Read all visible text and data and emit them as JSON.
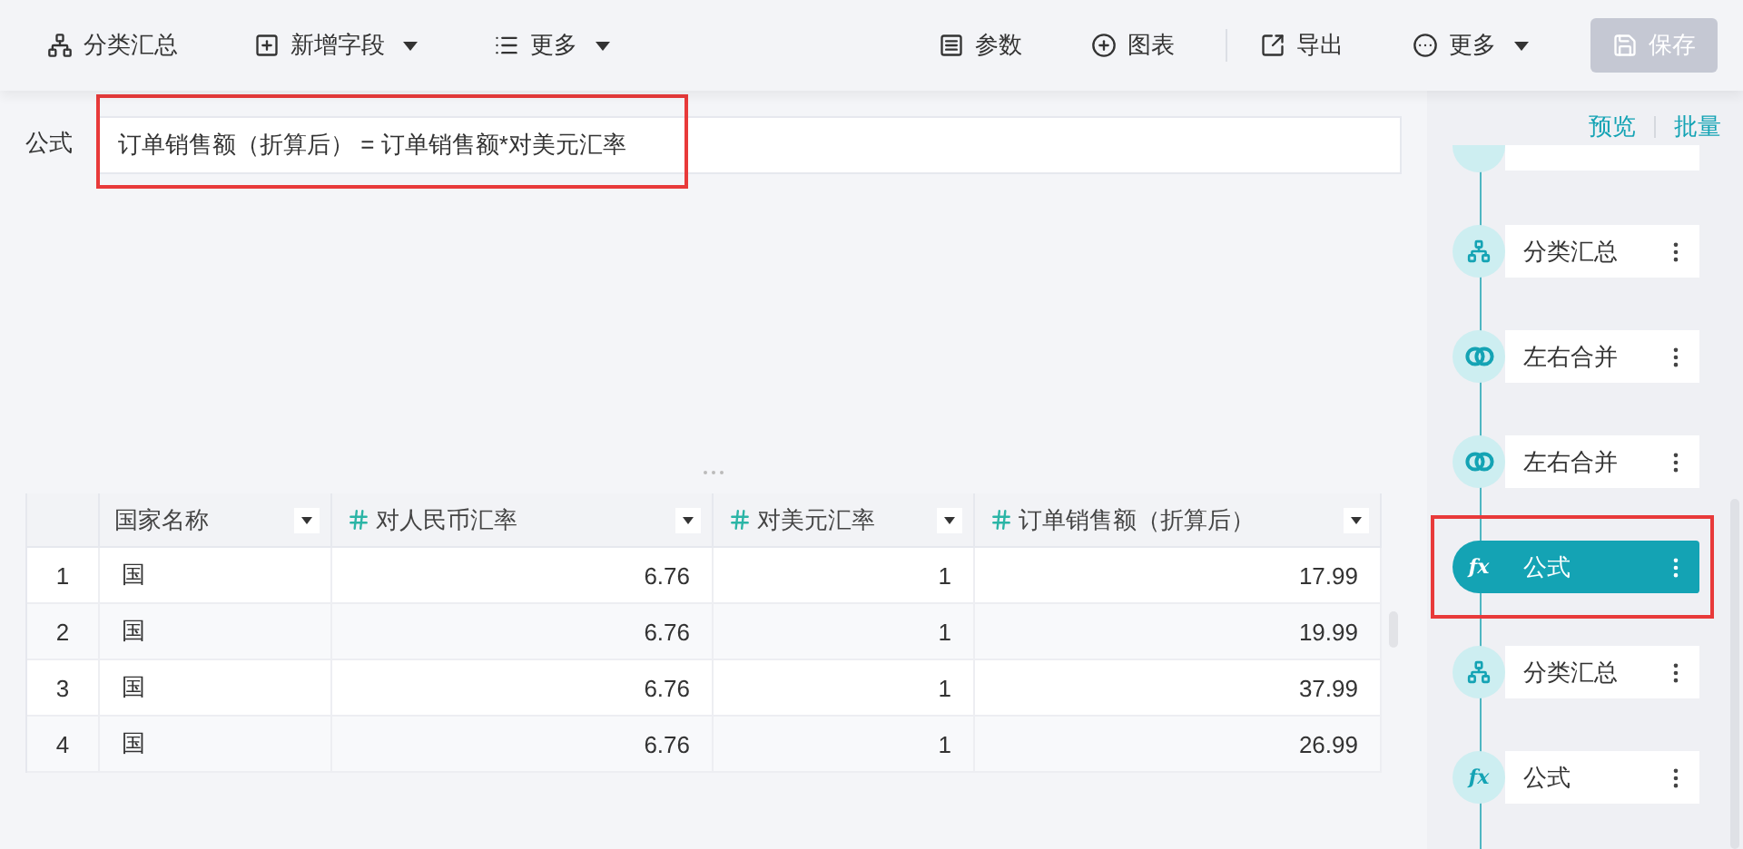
{
  "toolbar": {
    "left": [
      {
        "kind": "group",
        "label": "分类汇总",
        "dropdown": false
      },
      {
        "kind": "add-field",
        "label": "新增字段",
        "dropdown": true
      },
      {
        "kind": "list",
        "label": "更多",
        "dropdown": true
      }
    ],
    "right": [
      {
        "kind": "params",
        "label": "参数",
        "dropdown": false
      },
      {
        "kind": "chart",
        "label": "图表",
        "dropdown": false
      },
      {
        "kind": "export",
        "label": "导出",
        "dropdown": false
      },
      {
        "kind": "more",
        "label": "更多",
        "dropdown": true
      }
    ],
    "save": {
      "label": "保存",
      "disabled": true
    }
  },
  "formula": {
    "label": "公式",
    "value": "订单销售额（折算后） = 订单销售额*对美元汇率",
    "highlighted": true
  },
  "table": {
    "columns": [
      {
        "label": "国家名称",
        "kind": "text"
      },
      {
        "label": "对人民币汇率",
        "kind": "number"
      },
      {
        "label": "对美元汇率",
        "kind": "number"
      },
      {
        "label": "订单销售额（折算后）",
        "kind": "number"
      }
    ],
    "rows": [
      {
        "index": "1",
        "cells": [
          "国",
          "6.76",
          "1",
          "17.99"
        ]
      },
      {
        "index": "2",
        "cells": [
          "国",
          "6.76",
          "1",
          "19.99"
        ]
      },
      {
        "index": "3",
        "cells": [
          "国",
          "6.76",
          "1",
          "37.99"
        ]
      },
      {
        "index": "4",
        "cells": [
          "国",
          "6.76",
          "1",
          "26.99"
        ]
      }
    ]
  },
  "side_panel": {
    "links": [
      "预览",
      "批量"
    ],
    "steps": [
      {
        "selected": false,
        "highlighted": false,
        "partial": true
      },
      {
        "kind": "group",
        "label": "分类汇总",
        "selected": false,
        "highlighted": false,
        "partial": false
      },
      {
        "kind": "merge",
        "label": "左右合并",
        "selected": false,
        "highlighted": false,
        "partial": false
      },
      {
        "kind": "merge",
        "label": "左右合并",
        "selected": false,
        "highlighted": false,
        "partial": false
      },
      {
        "kind": "formula",
        "icon_text": "fx",
        "label": "公式",
        "selected": true,
        "highlighted": true,
        "partial": false
      },
      {
        "kind": "group",
        "label": "分类汇总",
        "selected": false,
        "highlighted": false,
        "partial": false
      },
      {
        "kind": "formula",
        "icon_text": "fx",
        "label": "公式",
        "selected": false,
        "highlighted": false,
        "partial": false
      }
    ]
  }
}
